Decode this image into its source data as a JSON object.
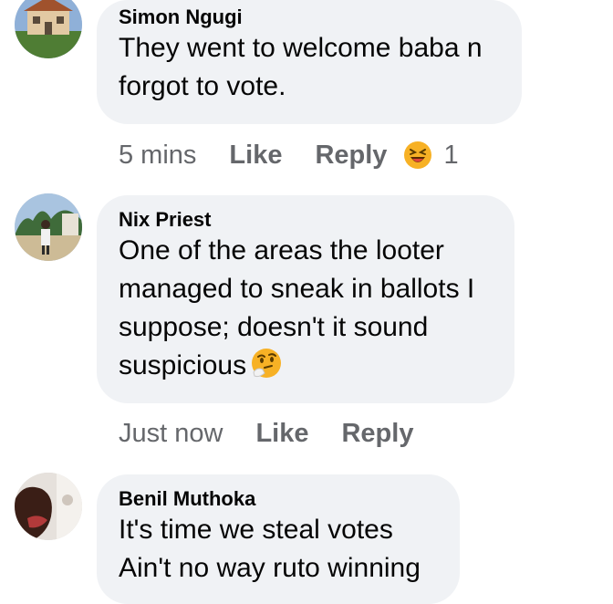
{
  "comments": [
    {
      "author": "Simon Ngugi",
      "lines": [
        "They went to welcome baba n",
        "forgot to vote."
      ],
      "time": "5 mins",
      "like_label": "Like",
      "reply_label": "Reply",
      "reaction_icon": "laughing-emoji",
      "reaction_count": "1"
    },
    {
      "author": "Nix Priest",
      "lines": [
        "One of the areas the looter",
        "managed to sneak in ballots I",
        "suppose; doesn't it sound",
        "suspicious"
      ],
      "inline_emoji": "thinking-face-emoji",
      "time": "Just now",
      "like_label": "Like",
      "reply_label": "Reply"
    },
    {
      "author": "Benil Muthoka",
      "lines": [
        "It's time we steal votes",
        "Ain't no way ruto winning"
      ]
    }
  ],
  "colors": {
    "bubble": "#f0f2f5",
    "text": "#050505",
    "meta": "#65676b"
  }
}
